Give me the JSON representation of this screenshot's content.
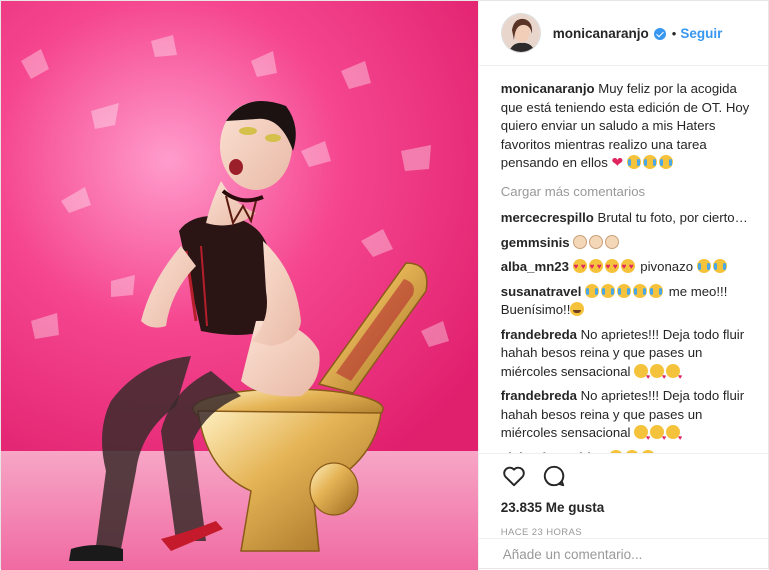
{
  "header": {
    "username": "monicanaranjo",
    "separator": "•",
    "follow_label": "Seguir"
  },
  "caption": {
    "username": "monicanaranjo",
    "text": "Muy feliz por la acogida que está teniendo esta edición de OT. Hoy quiero enviar un saludo a mis Haters favoritos mientras realizo una tarea pensando en ellos",
    "emojis": [
      "heart",
      "tears-of-joy",
      "tears-of-joy",
      "tears-of-joy"
    ]
  },
  "load_more_label": "Cargar más comentarios",
  "comments": [
    {
      "username": "mercecrespillo",
      "text": "Brutal tu foto, por cierto…"
    },
    {
      "username": "gemmsinis",
      "text": "",
      "emojis": [
        "clapping-hands",
        "clapping-hands",
        "clapping-hands"
      ]
    },
    {
      "username": "alba_mn23",
      "text": "pivonazo",
      "emojis_before": [
        "heart-eyes",
        "heart-eyes",
        "heart-eyes",
        "heart-eyes"
      ],
      "emojis_after": [
        "tears-of-joy",
        "tears-of-joy"
      ]
    },
    {
      "username": "susanatravel",
      "text": "me meo!!! Buenísimo!!",
      "emojis_before": [
        "tears-of-joy",
        "tears-of-joy",
        "tears-of-joy",
        "tears-of-joy",
        "tears-of-joy"
      ],
      "emojis_after": [
        "grinning-sweat"
      ]
    },
    {
      "username": "frandebreda",
      "text": "No aprietes!!! Deja todo fluir hahah besos reina y que pases un miércoles sensacional",
      "emojis": [
        "kiss",
        "kiss",
        "kiss"
      ]
    },
    {
      "username": "frandebreda",
      "text": "No aprietes!!! Deja todo fluir hahah besos reina y que pases un miércoles sensacional",
      "emojis": [
        "kiss",
        "kiss",
        "kiss"
      ]
    },
    {
      "username": "alejandrorvaldez",
      "text": "",
      "emojis": [
        "tears-of-joy",
        "tears-of-joy",
        "tears-of-joy"
      ]
    }
  ],
  "actions": {
    "like_icon": "heart-outline-icon",
    "comment_icon": "speech-bubble-icon"
  },
  "likes_label": "23.835 Me gusta",
  "timestamp": "HACE 23 HORAS",
  "add_comment_placeholder": "Añade un comentario...",
  "colors": {
    "accent": "#3897f0",
    "text": "#262626",
    "muted": "#999999",
    "photo_background": "#f0287c"
  }
}
